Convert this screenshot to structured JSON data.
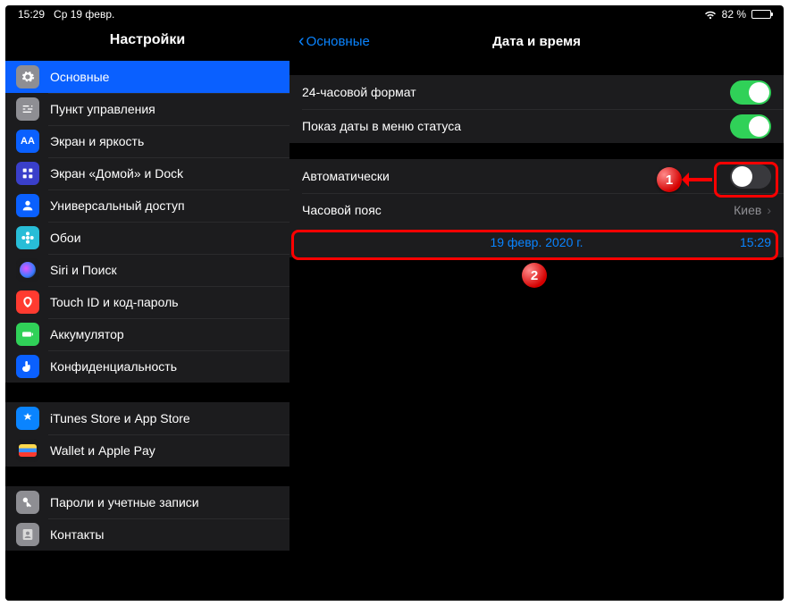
{
  "status": {
    "time": "15:29",
    "date": "Ср 19 февр.",
    "battery_pct": "82 %"
  },
  "sidebar": {
    "title": "Настройки",
    "groups": [
      [
        {
          "label": "Основные",
          "icon": "gear",
          "bg": "#8e8e93",
          "selected": true
        },
        {
          "label": "Пункт управления",
          "icon": "sliders",
          "bg": "#8e8e93"
        },
        {
          "label": "Экран и яркость",
          "icon": "AA",
          "bg": "#0a60ff"
        },
        {
          "label": "Экран «Домой» и Dock",
          "icon": "grid",
          "bg": "#3a3fca"
        },
        {
          "label": "Универсальный доступ",
          "icon": "person",
          "bg": "#0a60ff"
        },
        {
          "label": "Обои",
          "icon": "flower",
          "bg": "#28bdd7"
        },
        {
          "label": "Siri и Поиск",
          "icon": "siri",
          "bg": "#1b1b1d"
        },
        {
          "label": "Touch ID и код-пароль",
          "icon": "touch",
          "bg": "#ff3b30"
        },
        {
          "label": "Аккумулятор",
          "icon": "batt",
          "bg": "#30d158"
        },
        {
          "label": "Конфиденциальность",
          "icon": "hand",
          "bg": "#0a60ff"
        }
      ],
      [
        {
          "label": "iTunes Store и App Store",
          "icon": "appstore",
          "bg": "#0a84ff"
        },
        {
          "label": "Wallet и Apple Pay",
          "icon": "wallet",
          "bg": "#1b1b1d"
        }
      ],
      [
        {
          "label": "Пароли и учетные записи",
          "icon": "key",
          "bg": "#8e8e93"
        },
        {
          "label": "Контакты",
          "icon": "contacts",
          "bg": "#8e8e93"
        }
      ]
    ]
  },
  "main": {
    "back": "Основные",
    "title": "Дата и время",
    "g1": {
      "r0": {
        "label": "24-часовой формат",
        "on": true
      },
      "r1": {
        "label": "Показ даты в меню статуса",
        "on": true
      }
    },
    "g2": {
      "auto": {
        "label": "Автоматически",
        "on": false
      },
      "tz": {
        "label": "Часовой пояс",
        "value": "Киев"
      },
      "date": {
        "date": "19 февр. 2020 г.",
        "time": "15:29"
      }
    }
  },
  "annot": {
    "b1": "1",
    "b2": "2"
  }
}
